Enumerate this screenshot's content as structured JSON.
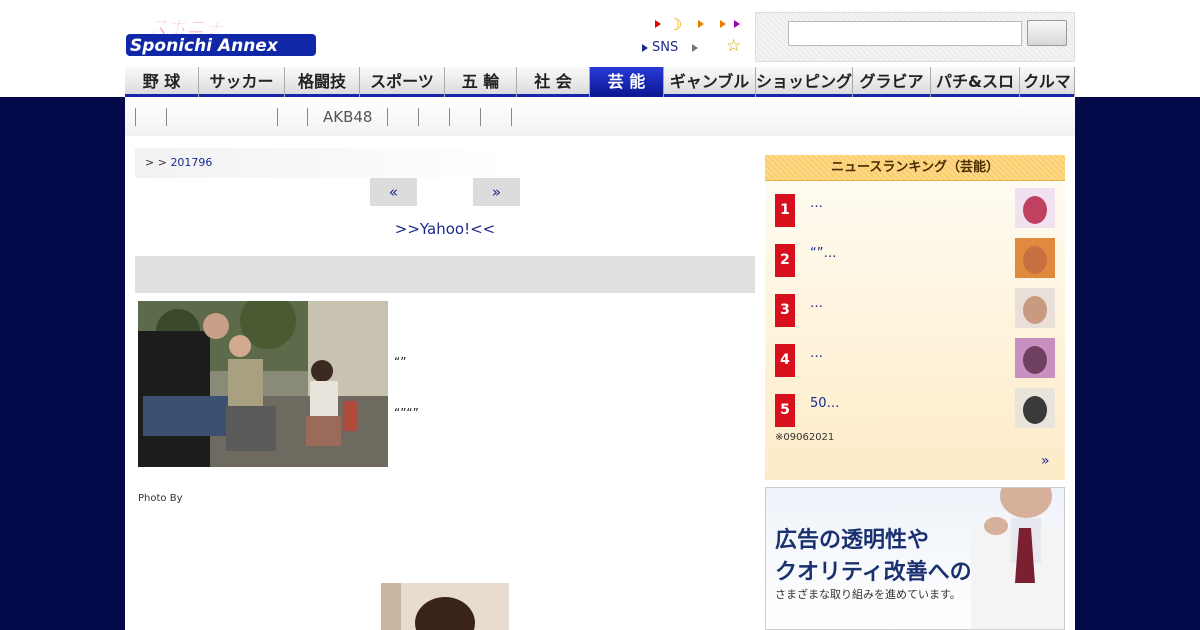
{
  "header": {
    "logo_top": "スポニチ",
    "logo_bottom": "Sponichi Annex",
    "sns_label": "SNS",
    "search_value": ""
  },
  "nav": {
    "items": [
      {
        "label": "野 球",
        "w": 74
      },
      {
        "label": "サッカー",
        "w": 86
      },
      {
        "label": "格闘技",
        "w": 75
      },
      {
        "label": "スポーツ",
        "w": 85
      },
      {
        "label": "五 輪",
        "w": 72
      },
      {
        "label": "社 会",
        "w": 73
      },
      {
        "label": "芸 能",
        "w": 74,
        "active": true
      },
      {
        "label": "ギャンブル",
        "w": 92
      },
      {
        "label": "ショッピング",
        "w": 97
      },
      {
        "label": "グラビア",
        "w": 78
      },
      {
        "label": "パチ&スロ",
        "w": 89
      },
      {
        "label": "クルマ",
        "w": 55
      }
    ]
  },
  "subnav": {
    "label": "AKB48"
  },
  "breadcrumb": {
    "prefix": ">  > ",
    "link": "201796"
  },
  "pager": {
    "prev": "«",
    "next": "»"
  },
  "article": {
    "yahoo_link": ">>Yahoo!<<",
    "caption1": "“”",
    "caption2": "“”“”",
    "photo_by": "Photo By"
  },
  "ranking": {
    "title": "ニュースランキング（芸能）",
    "items": [
      {
        "rank": "1",
        "title": "…"
      },
      {
        "rank": "2",
        "title": "“”…"
      },
      {
        "rank": "3",
        "title": "…"
      },
      {
        "rank": "4",
        "title": "…"
      },
      {
        "rank": "5",
        "title": "50…"
      }
    ],
    "note": "※09062021",
    "more": "»"
  },
  "ad": {
    "line1": "広告の透明性や",
    "line2": "クオリティ改善への",
    "line3": "さまざまな取り組みを進めています。"
  }
}
